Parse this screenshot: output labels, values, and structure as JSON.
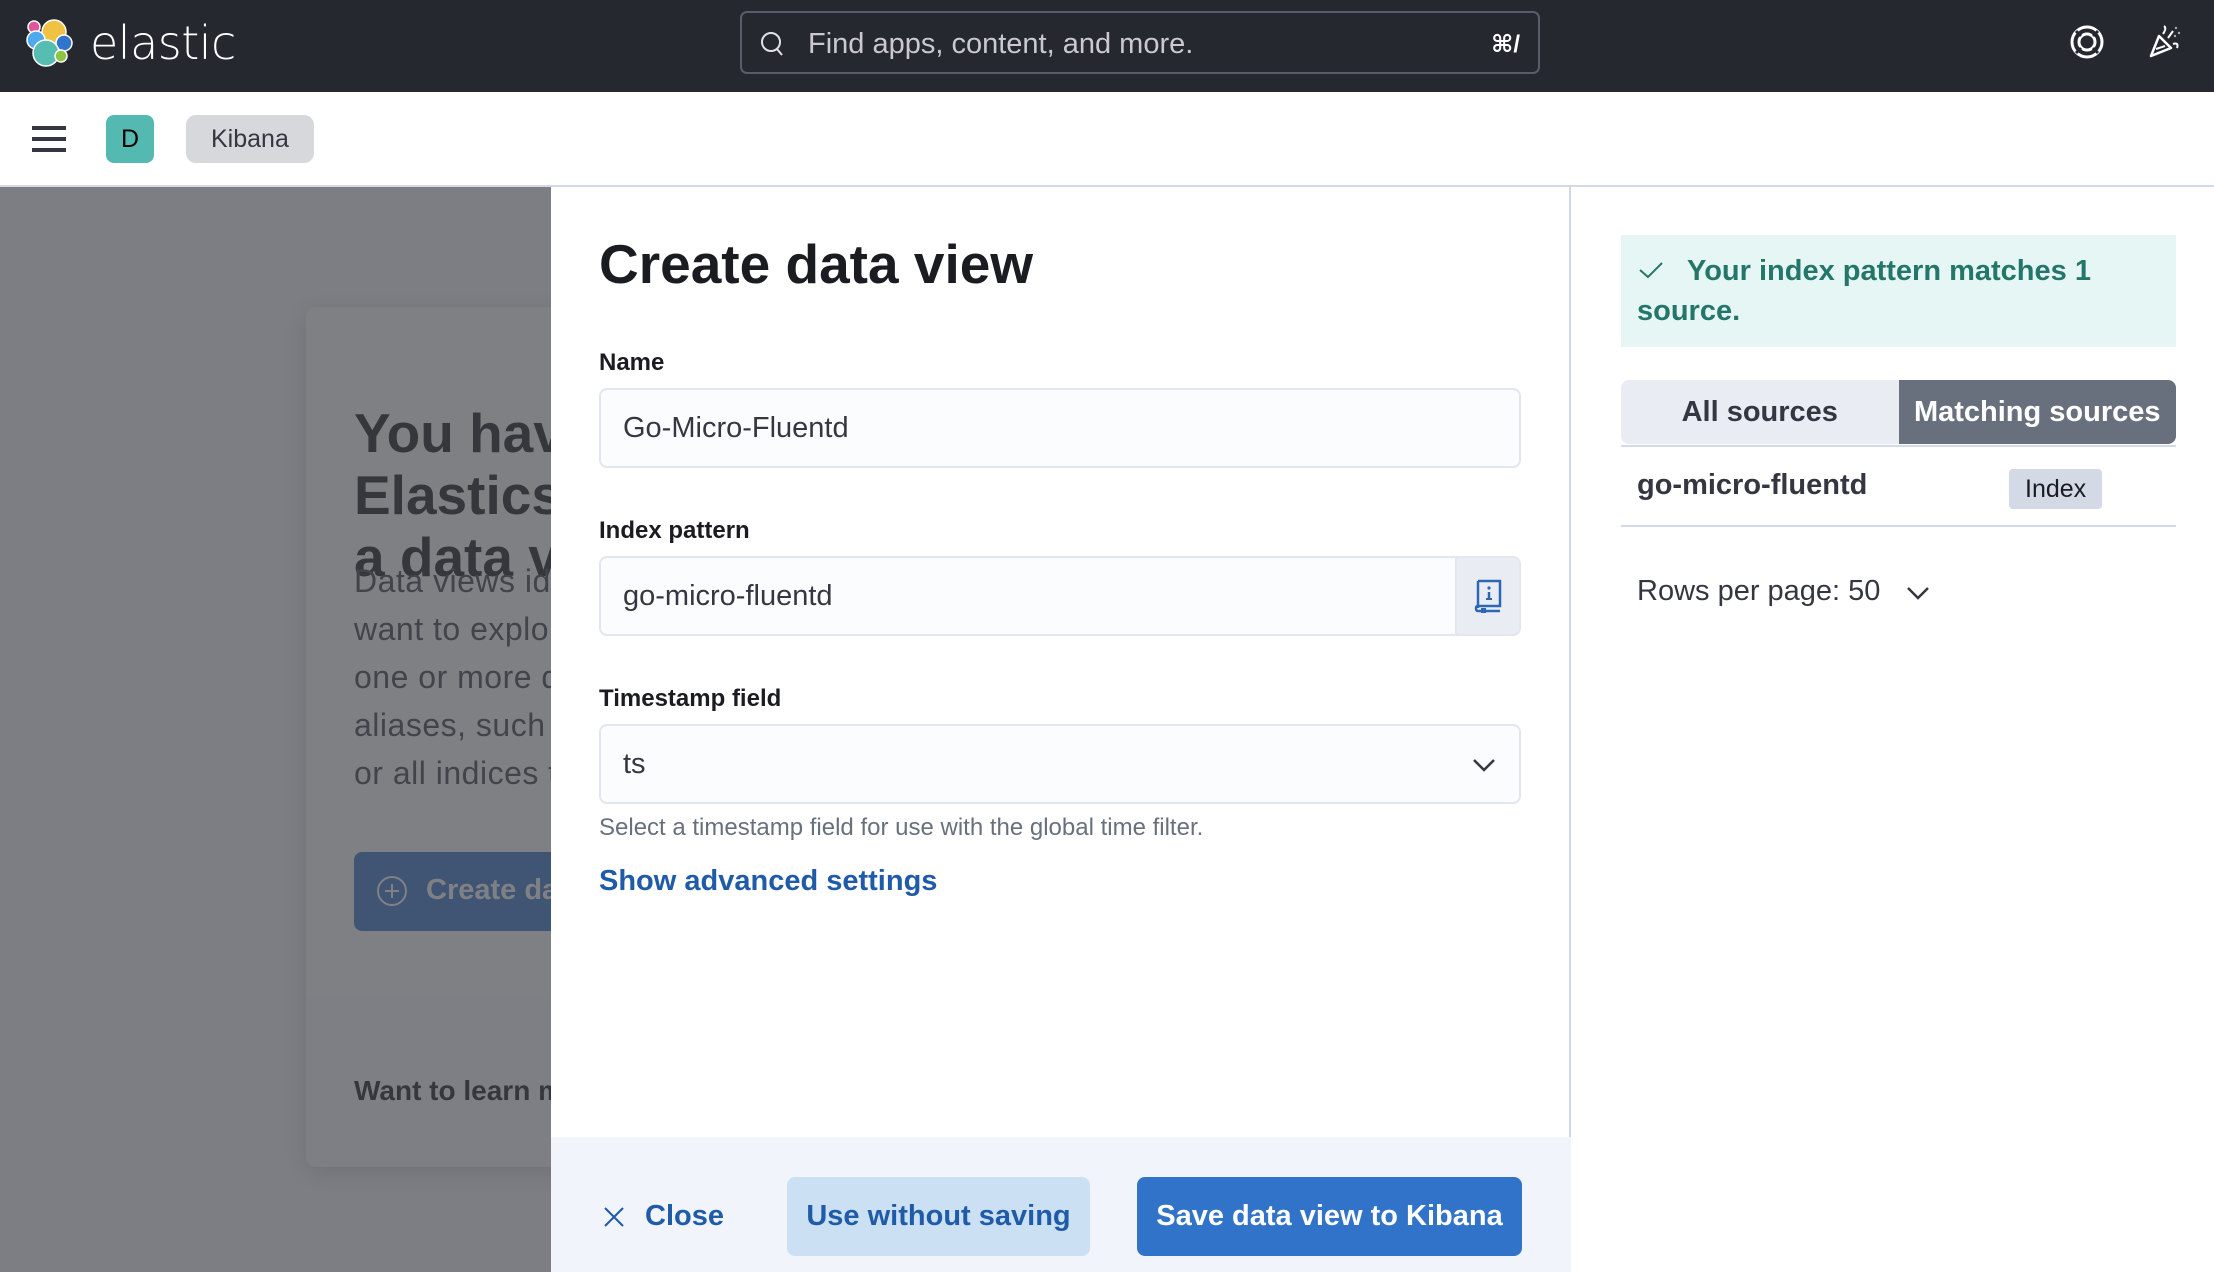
{
  "app": {
    "brand": "elastic"
  },
  "header": {
    "search_placeholder": "Find apps, content, and more.",
    "search_shortcut": "⌘/",
    "icons": [
      "help-lifebuoy-icon",
      "whats-new-party-icon"
    ]
  },
  "subheader": {
    "space_initial": "D",
    "space_color": "#54b9b0",
    "breadcrumb": "Kibana"
  },
  "background_page": {
    "title": "You have data in Elasticsearch. Now, create a data view.",
    "description": "Data views identify the Elasticsearch data you want to explore. You can point data views to one or more data streams, indices, and index aliases, such as your log data from yesterday, or all indices that contain your log data.",
    "create_button": "Create data view",
    "footer_text": "Want to learn more?"
  },
  "flyout": {
    "title": "Create data view",
    "fields": {
      "name": {
        "label": "Name",
        "value": "Go-Micro-Fluentd"
      },
      "index_pattern": {
        "label": "Index pattern",
        "value": "go-micro-fluentd"
      },
      "timestamp": {
        "label": "Timestamp field",
        "value": "ts",
        "help": "Select a timestamp field for use with the global time filter."
      }
    },
    "advanced_link": "Show advanced settings",
    "footer": {
      "close": "Close",
      "use_without_saving": "Use without saving",
      "save": "Save data view to Kibana"
    }
  },
  "preview": {
    "callout": "Your index pattern matches 1 source.",
    "tabs": [
      {
        "label": "All sources",
        "selected": false
      },
      {
        "label": "Matching sources",
        "selected": true
      }
    ],
    "rows": [
      {
        "name": "go-micro-fluentd",
        "type": "Index"
      }
    ],
    "rows_per_page": "Rows per page: 50"
  },
  "colors": {
    "primary": "#3173c8",
    "link": "#1f5ba8",
    "success_text": "#24766b",
    "success_bg": "#e6f6f4",
    "header_bg": "#25282f"
  }
}
